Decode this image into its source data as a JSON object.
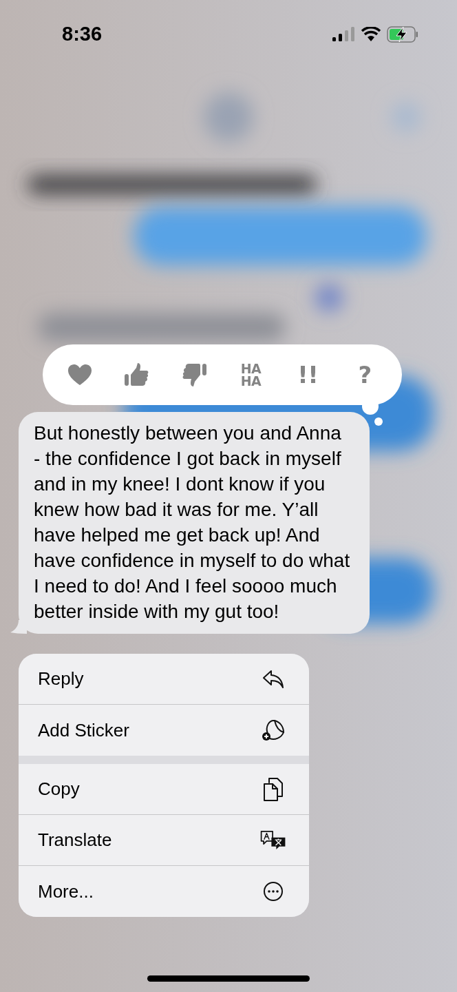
{
  "status_bar": {
    "time": "8:36"
  },
  "reactions": [
    {
      "kind": "heart"
    },
    {
      "kind": "thumbs-up"
    },
    {
      "kind": "thumbs-down"
    },
    {
      "kind": "text",
      "lines": [
        "HA",
        "HA"
      ]
    },
    {
      "kind": "text",
      "lines": [
        "!!"
      ]
    },
    {
      "kind": "text",
      "lines": [
        "?"
      ]
    }
  ],
  "message": {
    "text": "But honestly between you and Anna - the confidence I got back in myself and in my knee! I dont know if you knew how bad it was for me. Y’all have helped me get back up! And have confidence in myself to do what I need to do! And I feel soooo much better inside with my gut too!"
  },
  "menu_groups": [
    [
      {
        "label": "Reply",
        "kind": "reply"
      },
      {
        "label": "Add Sticker",
        "kind": "sticker"
      }
    ],
    [
      {
        "label": "Copy",
        "kind": "copy"
      },
      {
        "label": "Translate",
        "kind": "translate"
      },
      {
        "label": "More...",
        "kind": "more"
      }
    ]
  ]
}
